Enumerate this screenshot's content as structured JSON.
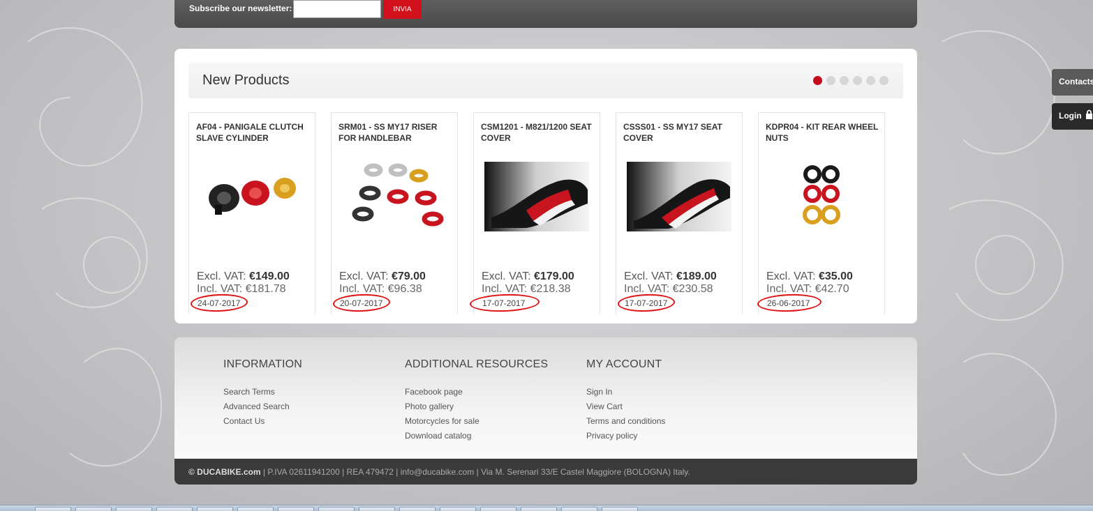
{
  "newsletter": {
    "label": "Subscribe our newsletter:",
    "input_value": "",
    "button_label": "INVIA"
  },
  "new_products": {
    "title": "New Products",
    "carousel_pages": 6,
    "active_page": 1,
    "items": [
      {
        "name": "AF04 - PANIGALE CLUTCH SLAVE CYLINDER",
        "excl_label": "Excl. VAT:",
        "excl_price": "€149.00",
        "incl_label": "Incl. VAT:",
        "incl_price": "€181.78",
        "date": "24-07-2017",
        "image": "clutch-cylinder-image"
      },
      {
        "name": "SRM01 - SS MY17 RISER FOR HANDLEBAR",
        "excl_label": "Excl. VAT:",
        "excl_price": "€79.00",
        "incl_label": "Incl. VAT:",
        "incl_price": "€96.38",
        "date": "20-07-2017",
        "image": "handlebar-riser-image"
      },
      {
        "name": "CSM1201 - M821/1200 SEAT COVER",
        "excl_label": "Excl. VAT:",
        "excl_price": "€179.00",
        "incl_label": "Incl. VAT:",
        "incl_price": "€218.38",
        "date": "17-07-2017",
        "image": "seat-cover-image"
      },
      {
        "name": "CSSS01 - SS MY17 SEAT COVER",
        "excl_label": "Excl. VAT:",
        "excl_price": "€189.00",
        "incl_label": "Incl. VAT:",
        "incl_price": "€230.58",
        "date": "17-07-2017",
        "image": "seat-cover-image"
      },
      {
        "name": "KDPR04 - KIT REAR WHEEL NUTS",
        "excl_label": "Excl. VAT:",
        "excl_price": "€35.00",
        "incl_label": "Incl. VAT:",
        "incl_price": "€42.70",
        "date": "26-06-2017",
        "image": "wheel-nuts-image"
      }
    ]
  },
  "footer": {
    "columns": [
      {
        "heading": "INFORMATION",
        "links": [
          "Search Terms",
          "Advanced Search",
          "Contact Us"
        ]
      },
      {
        "heading": "ADDITIONAL RESOURCES",
        "links": [
          "Facebook page",
          "Photo gallery",
          "Motorcycles for sale",
          "Download catalog"
        ]
      },
      {
        "heading": "MY ACCOUNT",
        "links": [
          "Sign In",
          "View Cart",
          "Terms and conditions",
          "Privacy policy"
        ]
      }
    ],
    "copyright_brand": "© DUCABIKE.com",
    "copyright_rest": " | P.IVA 02611941200 | REA 479472 | info@ducabike.com | Via M. Serenari 33/E Castel Maggiore (BOLOGNA) Italy."
  },
  "side_tabs": {
    "contacts": "Contacts",
    "login": "Login"
  },
  "colors": {
    "accent_red": "#c40d1a",
    "annotation_red": "#e01010",
    "dark_bar": "#3a3a3a"
  }
}
